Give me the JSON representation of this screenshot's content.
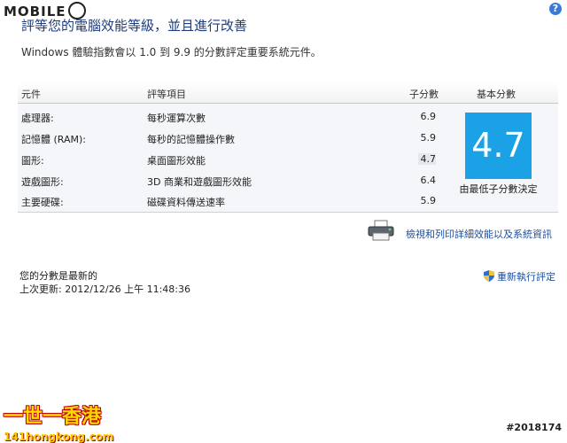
{
  "watermark": {
    "logo": "MOBILE",
    "brand": "一世一香港",
    "url": "141hongkong.com",
    "post_id": "#2018174"
  },
  "window": {
    "title": "評等您的電腦效能等級，並且進行改善",
    "help": "?"
  },
  "subtitle": "Windows 體驗指數會以 1.0 到 9.9 的分數評定重要系統元件。",
  "table": {
    "headers": {
      "component": "元件",
      "rating": "評等項目",
      "subscore": "子分數",
      "basescore": "基本分數"
    },
    "rows": [
      {
        "component": "處理器:",
        "rating": "每秒運算次數",
        "subscore": "6.9"
      },
      {
        "component": "記憶體 (RAM):",
        "rating": "每秒的記憶體操作數",
        "subscore": "5.9"
      },
      {
        "component": "圖形:",
        "rating": "桌面圖形效能",
        "subscore": "4.7"
      },
      {
        "component": "遊戲圖形:",
        "rating": "3D 商業和遊戲圖形效能",
        "subscore": "6.4"
      },
      {
        "component": "主要硬碟:",
        "rating": "磁碟資料傳送速率",
        "subscore": "5.9"
      }
    ],
    "base_score": "4.7",
    "base_caption": "由最低子分數決定"
  },
  "links": {
    "print": "檢視和列印詳細效能以及系統資訊",
    "rerun": "重新執行評定"
  },
  "status": {
    "line1": "您的分數是最新的",
    "line2": "上次更新: 2012/12/26 上午 11:48:36"
  },
  "colors": {
    "base_box": "#1aa1e6",
    "link": "#1c4e9c",
    "title": "#1f3d7a"
  }
}
